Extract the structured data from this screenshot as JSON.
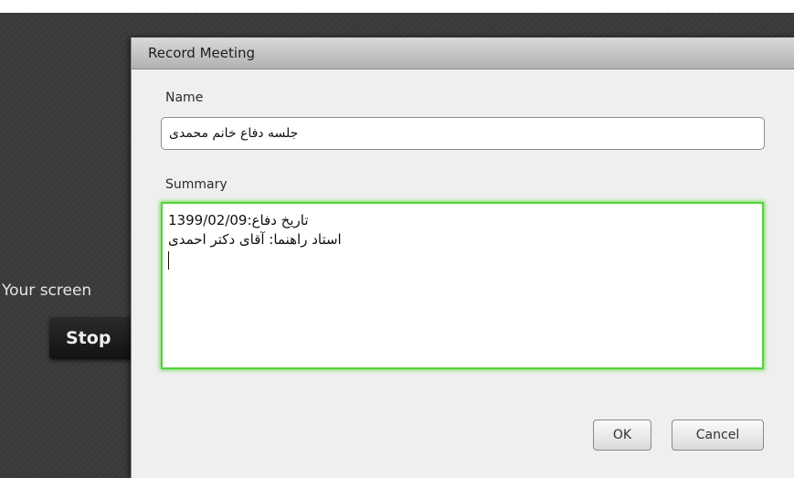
{
  "background": {
    "share_message": "Your screen",
    "stop_button_label": "Stop"
  },
  "dialog": {
    "title": "Record Meeting",
    "name_label": "Name",
    "name_value": "جلسه دفاع خانم محمدی",
    "summary_label": "Summary",
    "summary_lines": [
      "تاریخ دفاع:1399/02/09",
      "استاد راهنما: آقای دکتر احمدی"
    ],
    "ok_label": "OK",
    "cancel_label": "Cancel"
  },
  "colors": {
    "focus_glow": "#55d43c",
    "backdrop": "#3a3a3a"
  }
}
